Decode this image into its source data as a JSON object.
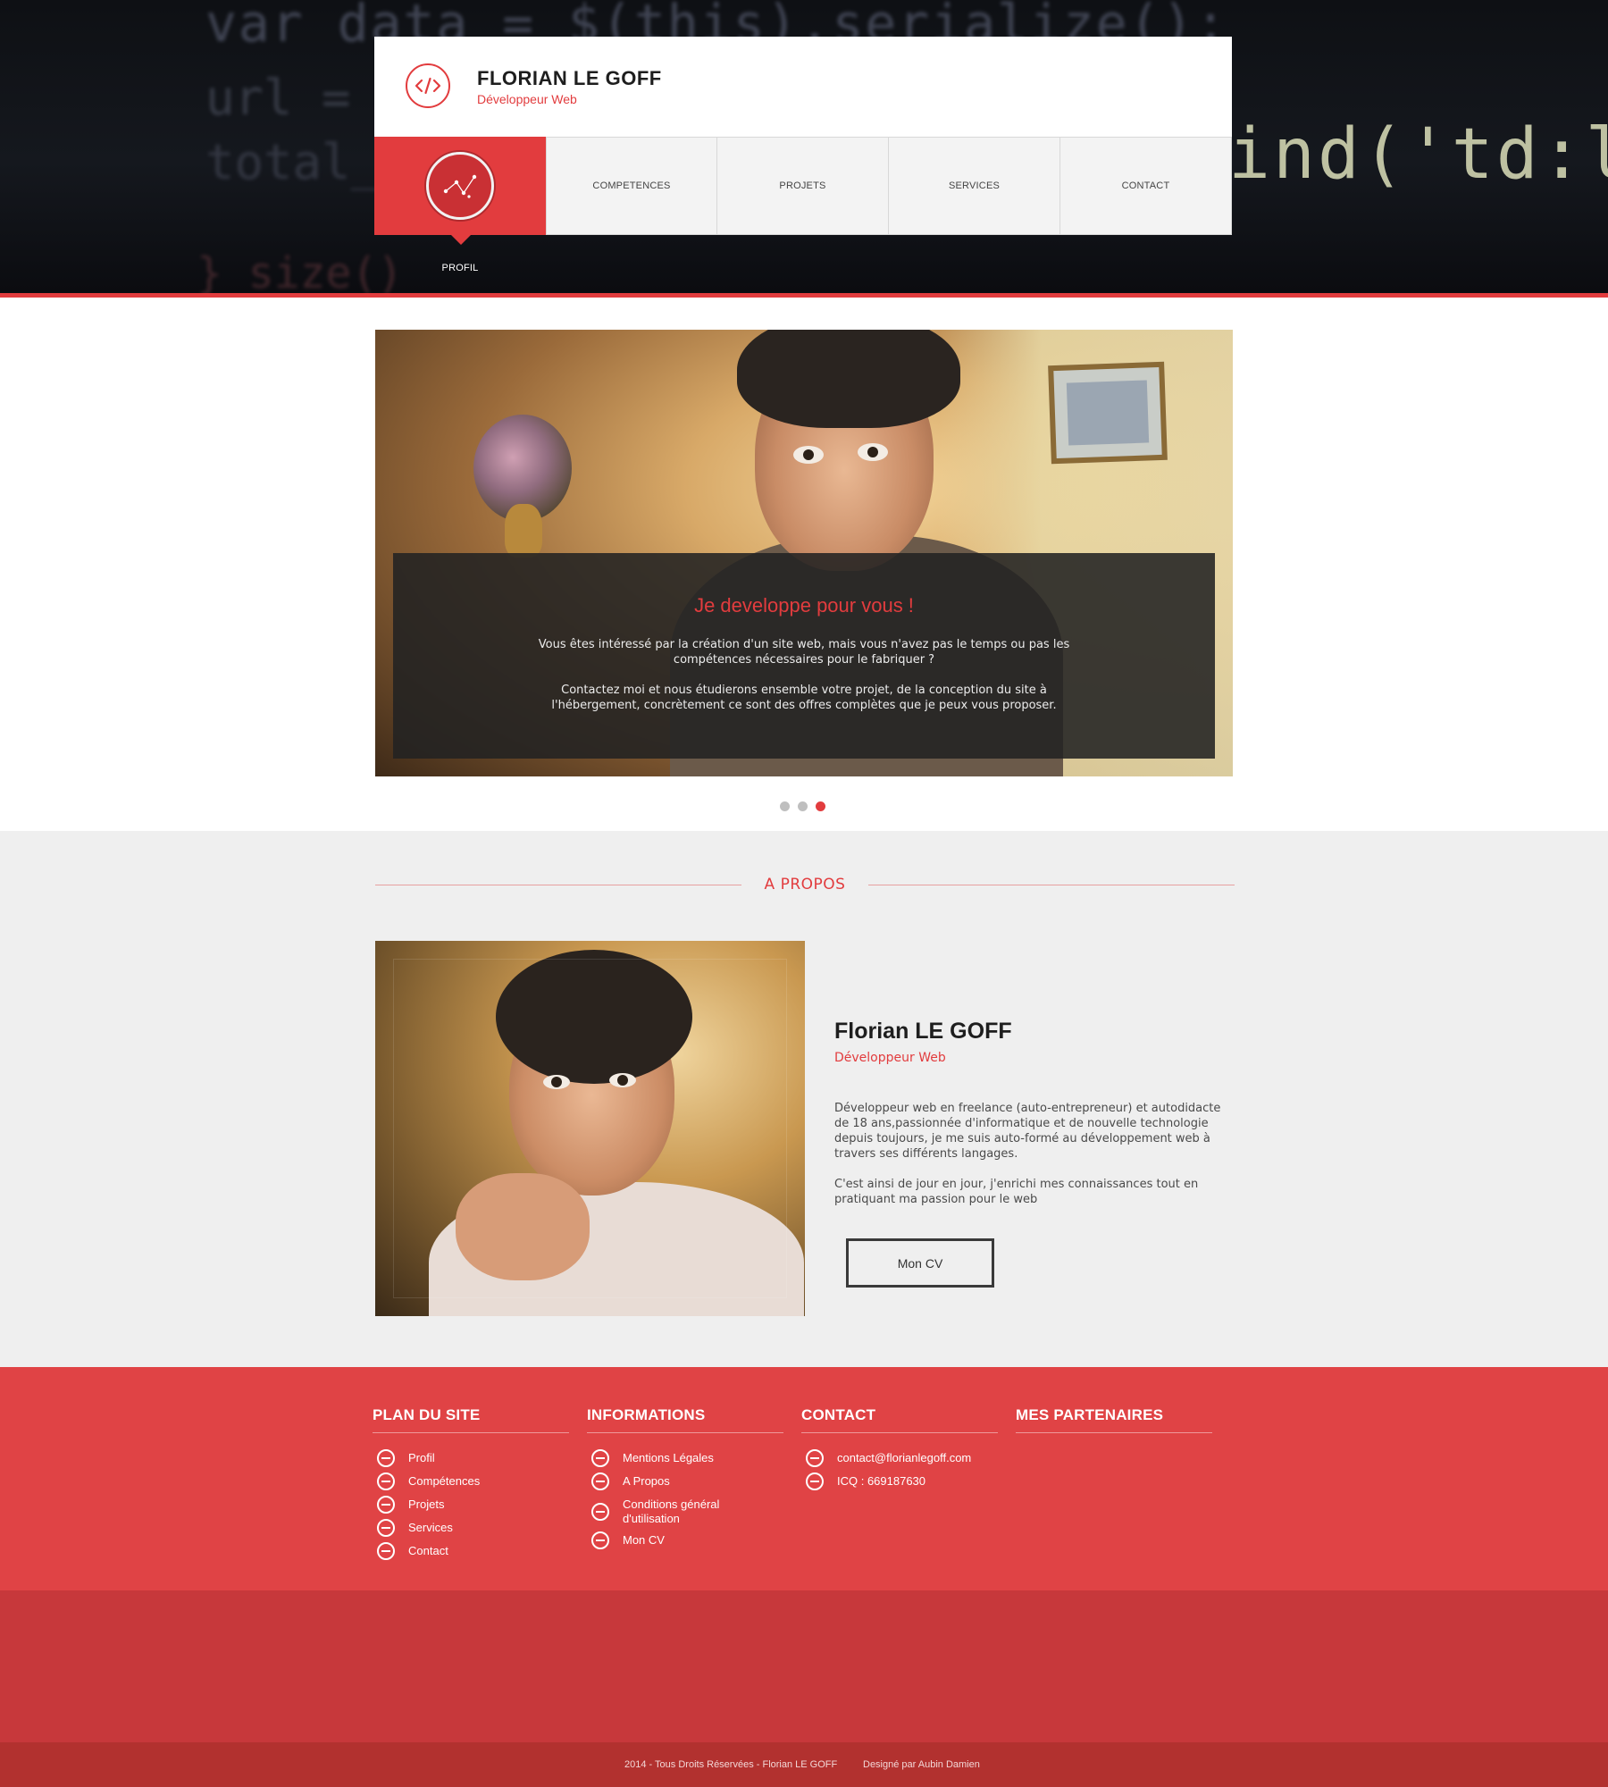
{
  "colors": {
    "accent": "#e23c3e",
    "footer": "#e04345",
    "footer_dark": "#c7383b",
    "copyright_bar": "#b2312f",
    "about_bg": "#efefef"
  },
  "header": {
    "brand_name": "FLORIAN LE GOFF",
    "brand_subtitle": "Développeur Web",
    "logo_icon": "code-icon",
    "background_code": {
      "line1": "var data = $(this).serialize();",
      "line2": "url = $(",
      "line3": "total_fo",
      "line4": "}_size()",
      "line5": "ind('td:las"
    }
  },
  "nav": {
    "active": {
      "label": "PROFIL",
      "icon": "constellation-icon"
    },
    "items": [
      {
        "label": "COMPETENCES"
      },
      {
        "label": "PROJETS"
      },
      {
        "label": "SERVICES"
      },
      {
        "label": "CONTACT"
      }
    ]
  },
  "slider": {
    "title": "Je developpe pour vous !",
    "paragraph1": "Vous êtes intéressé par la création d'un site web, mais vous n'avez pas le temps ou pas les compétences nécessaires pour le fabriquer ?",
    "paragraph2": "Contactez moi et nous étudierons ensemble votre projet, de la conception du site à l'hébergement, concrètement ce sont des offres complètes que je peux vous proposer.",
    "dots": {
      "count": 3,
      "active_index": 2
    }
  },
  "about": {
    "heading": "A PROPOS",
    "name": "Florian LE GOFF",
    "role": "Développeur Web",
    "paragraph1": "Développeur web en freelance (auto-entrepreneur) et autodidacte de 18 ans,passionnée d'informatique et de nouvelle technologie depuis toujours, je me suis auto-formé au développement web à travers ses différents langages.",
    "paragraph2": "C'est ainsi de jour en jour, j'enrichi mes connaissances tout en pratiquant ma passion pour le web",
    "cv_button": "Mon CV"
  },
  "footer": {
    "sitemap": {
      "title": "PLAN DU SITE",
      "items": [
        "Profil",
        "Compétences",
        "Projets",
        "Services",
        "Contact"
      ]
    },
    "informations": {
      "title": "INFORMATIONS",
      "items": [
        "Mentions Légales",
        "A Propos",
        "Conditions général d'utilisation",
        "Mon CV"
      ]
    },
    "contact": {
      "title": "CONTACT",
      "items": [
        "contact@florianlegoff.com",
        "ICQ : 669187630"
      ]
    },
    "partners": {
      "title": "MES PARTENAIRES"
    },
    "list_icon": "minus-circle-icon"
  },
  "copyright": {
    "text": "2014 - Tous Droits Réservées  - Florian LE GOFF",
    "designer": "Designé par Aubin Damien"
  }
}
